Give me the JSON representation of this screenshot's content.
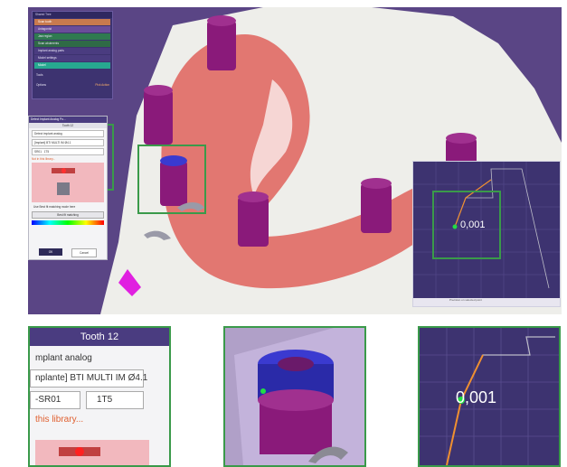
{
  "workflow": {
    "header": "Shared Tree",
    "items": [
      "Scan tooth",
      "Antagonist",
      "Jaw region",
      "Scan abutments",
      "Implant analog parts",
      "Model settings",
      "Model"
    ],
    "tools_label": "Tools",
    "options_label": "Options",
    "options_action": "Pick Action"
  },
  "detect_panel": {
    "title": "Detect Implant Analog Po...",
    "subtitle": "Tooth 12",
    "section": "Detect implant analog",
    "library_value": "[Implant] BTI MULTI IM Ø4.1",
    "variant_value": "SR01",
    "position_value": "1T5",
    "warn_link": "Not in this library...",
    "note": "Use Best fit matching mode here",
    "best_fit_button": "Best fit matching",
    "ok": "OK",
    "cancel": "Cancel"
  },
  "inset": {
    "readout": "0,001",
    "toolbar_text": "Precision on selected point"
  },
  "zoom_left": {
    "title": "Tooth 12",
    "line1": "mplant analog",
    "line2": "nplante] BTI MULTI IM Ø4.1",
    "line3": "-SR01",
    "line4": "1T5",
    "line5": "this library..."
  },
  "zoom_right": {
    "readout": "0,001"
  },
  "colors": {
    "background": "#5a4585",
    "highlight": "#3a9a4a",
    "implant": "#8a1a7a",
    "gingiva": "#e0706a",
    "model": "#eeeeea",
    "graph_line": "#f09030",
    "point": "#22dd44"
  }
}
